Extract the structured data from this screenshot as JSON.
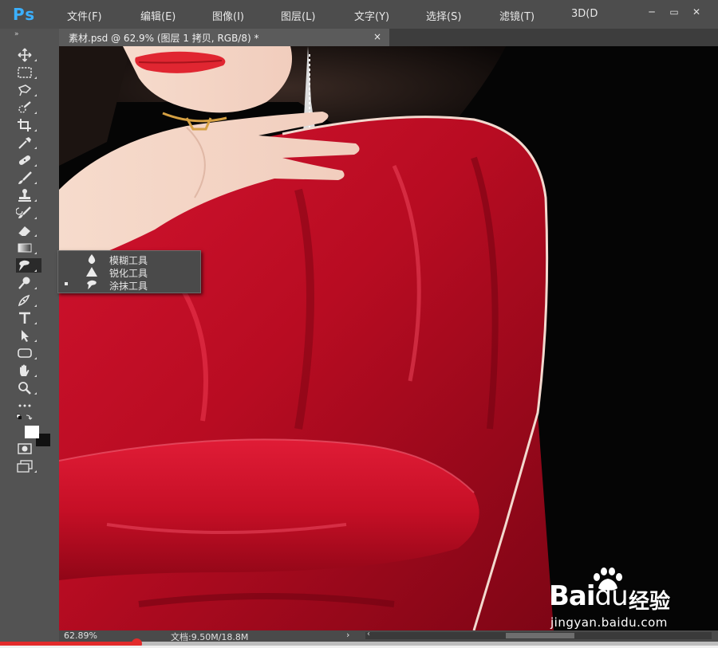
{
  "app": {
    "logo": "Ps"
  },
  "menu": [
    {
      "label": "文件(F)"
    },
    {
      "label": "编辑(E)"
    },
    {
      "label": "图像(I)"
    },
    {
      "label": "图层(L)"
    },
    {
      "label": "文字(Y)"
    },
    {
      "label": "选择(S)"
    },
    {
      "label": "滤镜(T)"
    },
    {
      "label": "3D(D"
    }
  ],
  "window_controls": {
    "minimize": "─",
    "maximize": "▭",
    "close": "✕"
  },
  "toolbar": {
    "collapse_glyph": "»",
    "tools": [
      {
        "name": "move-tool-icon"
      },
      {
        "name": "marquee-tool-icon"
      },
      {
        "name": "lasso-tool-icon"
      },
      {
        "name": "quick-select-tool-icon"
      },
      {
        "name": "crop-tool-icon"
      },
      {
        "name": "eyedropper-tool-icon"
      },
      {
        "name": "healing-brush-tool-icon"
      },
      {
        "name": "brush-tool-icon"
      },
      {
        "name": "clone-stamp-tool-icon"
      },
      {
        "name": "history-brush-tool-icon"
      },
      {
        "name": "eraser-tool-icon"
      },
      {
        "name": "gradient-tool-icon"
      },
      {
        "name": "smudge-tool-icon",
        "active": true
      },
      {
        "name": "dodge-tool-icon"
      },
      {
        "name": "pen-tool-icon"
      },
      {
        "name": "type-tool-icon",
        "glyph": "T"
      },
      {
        "name": "path-select-tool-icon"
      },
      {
        "name": "shape-tool-icon"
      },
      {
        "name": "hand-tool-icon"
      },
      {
        "name": "zoom-tool-icon"
      },
      {
        "name": "more-tools-icon",
        "glyph": "···"
      },
      {
        "name": "swap-colors-icon"
      },
      {
        "name": "color-swatches-icon"
      },
      {
        "name": "quick-mask-icon"
      },
      {
        "name": "screen-mode-icon"
      }
    ]
  },
  "document": {
    "tab_title": "素材.psd @ 62.9% (图层 1 拷贝, RGB/8) *",
    "close_glyph": "×"
  },
  "flyout": {
    "items": [
      {
        "label": "模糊工具",
        "icon": "blur-drop-icon",
        "selected": false
      },
      {
        "label": "锐化工具",
        "icon": "sharpen-triangle-icon",
        "selected": false
      },
      {
        "label": "涂抹工具",
        "icon": "smudge-finger-icon",
        "selected": true
      }
    ]
  },
  "status": {
    "zoom": "62.89%",
    "doc_info": "文档:9.50M/18.8M",
    "arrow": "›",
    "scroll_left_glyph": "‹"
  },
  "video": {
    "progress": 0.19
  },
  "watermark": {
    "brand": "Bai",
    "brand_du": "du",
    "product": "经验",
    "url": "jingyan.baidu.com"
  },
  "colors": {
    "ui_bg": "#535353",
    "menubar": "#4d4d4d",
    "accent_ps": "#3bb0ff",
    "dress_red": "#c8102e",
    "progress_red": "#e22b2b"
  }
}
